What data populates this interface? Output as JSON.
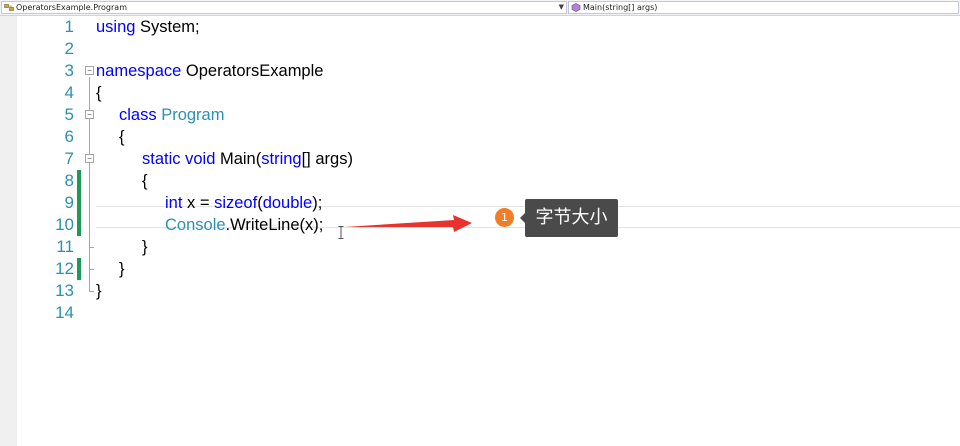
{
  "navbar": {
    "type_scope": "OperatorsExample.Program",
    "member_scope": "Main(string[] args)"
  },
  "editor": {
    "line_numbers": [
      "1",
      "2",
      "3",
      "4",
      "5",
      "6",
      "7",
      "8",
      "9",
      "10",
      "11",
      "12",
      "13",
      "14"
    ],
    "lines": {
      "l1": {
        "kw": "using",
        "rest": " System;"
      },
      "l3": {
        "kw": "namespace",
        "rest": " OperatorsExample"
      },
      "l4": {
        "text": "{"
      },
      "l5": {
        "kw": "class",
        "type": "Program"
      },
      "l6": {
        "text": "{"
      },
      "l7": {
        "kw1": "static",
        "kw2": "void",
        "mid": " Main(",
        "kw3": "string",
        "rest": "[] args)"
      },
      "l8": {
        "text": "{"
      },
      "l9": {
        "kw1": "int",
        "mid": " x = ",
        "kw2": "sizeof",
        "p1": "(",
        "kw3": "double",
        "rest": ");"
      },
      "l10": {
        "type": "Console",
        "rest": ".WriteLine(x);"
      },
      "l11": {
        "text": "}"
      },
      "l12": {
        "text": "}"
      },
      "l13": {
        "text": "}"
      }
    }
  },
  "annotation": {
    "badge_number": "1",
    "tooltip_text": "字节大小",
    "colors": {
      "arrow": "#e8322d",
      "badge": "#f07e29",
      "tooltip_bg": "#4a4a4a"
    }
  },
  "colors": {
    "keyword": "#0000ff",
    "type": "#2b91af",
    "line_number": "#2b91af",
    "change_bar": "#1f9a54"
  }
}
